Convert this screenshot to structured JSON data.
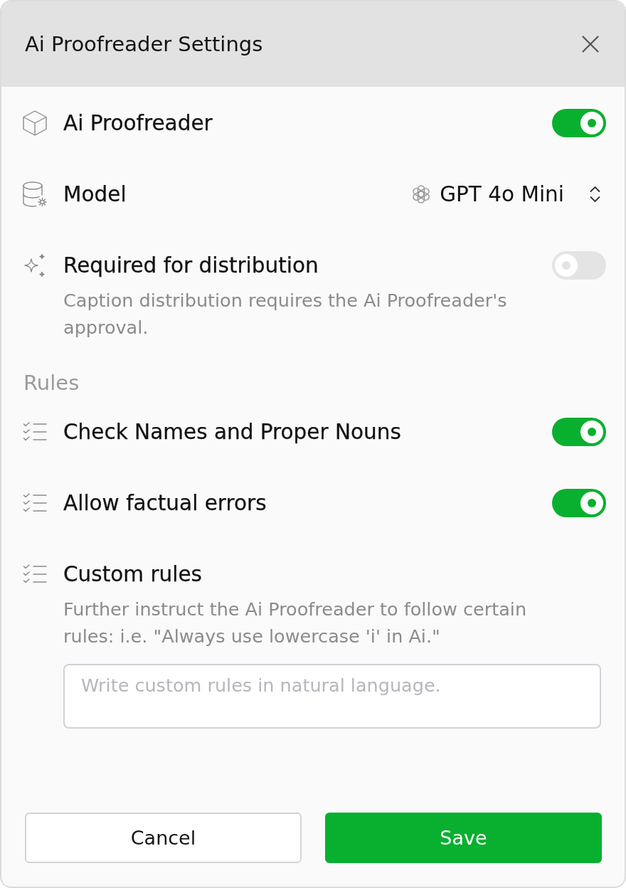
{
  "dialog": {
    "title": "Ai Proofreader Settings"
  },
  "settings": [
    {
      "kind": "toggle",
      "label": "Ai Proofreader",
      "on": true
    },
    {
      "kind": "select",
      "label": "Model",
      "value": "GPT 4o Mini"
    },
    {
      "kind": "toggle",
      "label": "Required for distribution",
      "on": false,
      "description": "Caption distribution requires the Ai Proofreader's approval."
    }
  ],
  "rules": {
    "heading": "Rules",
    "items": [
      {
        "kind": "toggle",
        "label": "Check Names and Proper Nouns",
        "on": true
      },
      {
        "kind": "toggle",
        "label": "Allow factual errors",
        "on": true
      },
      {
        "kind": "textarea",
        "label": "Custom rules",
        "description": "Further instruct the Ai Proofreader to follow certain rules: i.e. \"Always use lowercase 'i' in Ai.\"",
        "placeholder": "Write custom rules in natural language."
      }
    ]
  },
  "buttons": [
    {
      "kind": "secondary",
      "label": "Cancel"
    },
    {
      "kind": "primary",
      "label": "Save"
    }
  ]
}
